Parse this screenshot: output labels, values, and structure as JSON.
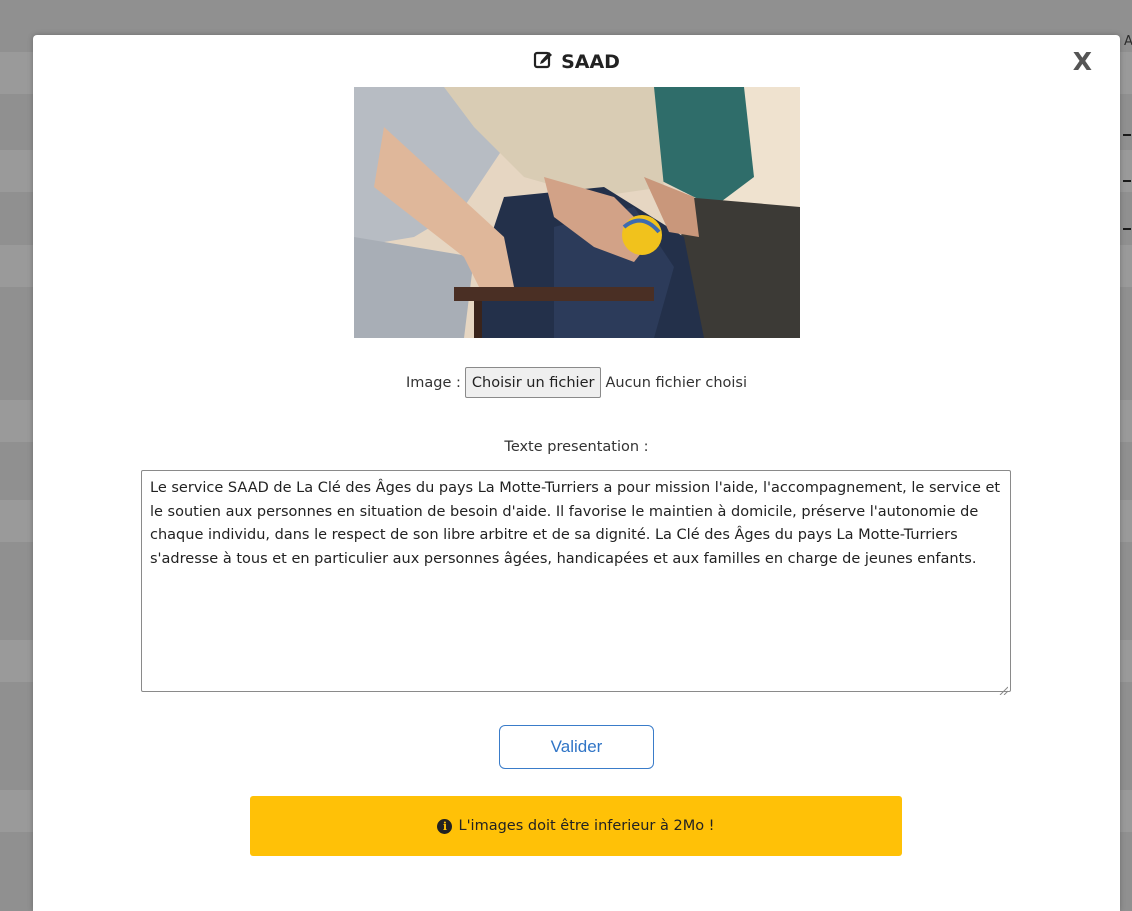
{
  "background": {
    "edge_letter": "A"
  },
  "modal": {
    "title": "SAAD",
    "title_icon": "edit-icon",
    "close_label": "X"
  },
  "image_field": {
    "label": "Image :",
    "button_label": "Choisir un fichier",
    "status": "Aucun fichier choisi"
  },
  "presentation": {
    "label": "Texte presentation :",
    "value": "Le service SAAD de La Clé des Âges du pays La Motte-Turriers a pour mission l'aide, l'accompagnement, le service et le soutien aux personnes en situation de besoin d'aide. Il favorise le maintien à domicile, préserve l'autonomie de chaque individu, dans le respect de son libre arbitre et de sa dignité. La Clé des Âges du pays La Motte-Turriers s'adresse à tous et en particulier aux personnes âgées, handicapées et aux familles en charge de jeunes enfants."
  },
  "submit": {
    "label": "Valider"
  },
  "alert": {
    "icon": "info-icon",
    "message": "L'images doit être inferieur à 2Mo !"
  },
  "colors": {
    "accent": "#3a7cc9",
    "warning": "#ffc107",
    "overlay": "#909090"
  }
}
